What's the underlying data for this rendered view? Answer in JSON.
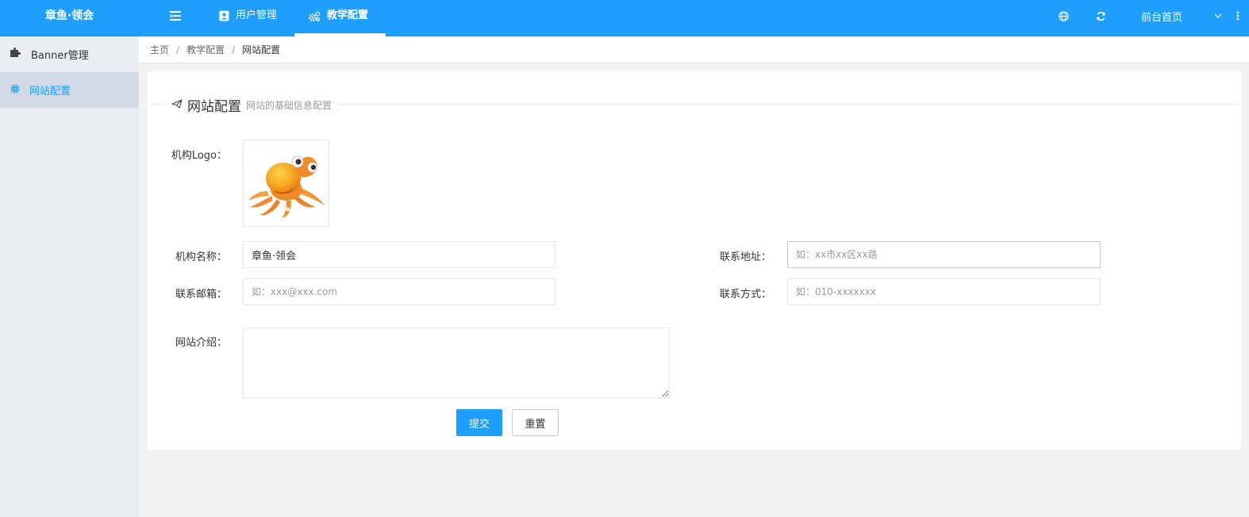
{
  "header": {
    "brand": "章鱼·领会",
    "nav": [
      {
        "label": "用户管理"
      },
      {
        "label": "教学配置"
      }
    ],
    "home_label": "前台首页"
  },
  "sidebar": {
    "items": [
      {
        "label": "Banner管理"
      },
      {
        "label": "网站配置"
      }
    ]
  },
  "breadcrumb": {
    "items": [
      "主页",
      "教学配置",
      "网站配置"
    ],
    "separator": "/"
  },
  "section": {
    "title": "网站配置",
    "subtitle": "网站的基础信息配置"
  },
  "form": {
    "logo_label": "机构Logo：",
    "name_label": "机构名称：",
    "name_value": "章鱼·领会",
    "address_label": "联系地址：",
    "address_placeholder": "如：xx市xx区xx路",
    "email_label": "联系邮箱：",
    "email_placeholder": "如：xxx@xxx.com",
    "phone_label": "联系方式：",
    "phone_placeholder": "如：010-xxxxxxx",
    "intro_label": "网站介绍：",
    "intro_value": "",
    "submit_label": "提交",
    "reset_label": "重置"
  },
  "colors": {
    "header_bg": "#1e9fff",
    "sidebar_bg": "#eaedf1",
    "sidebar_active_bg": "#d2dbe5",
    "accent": "#1e9fff"
  }
}
